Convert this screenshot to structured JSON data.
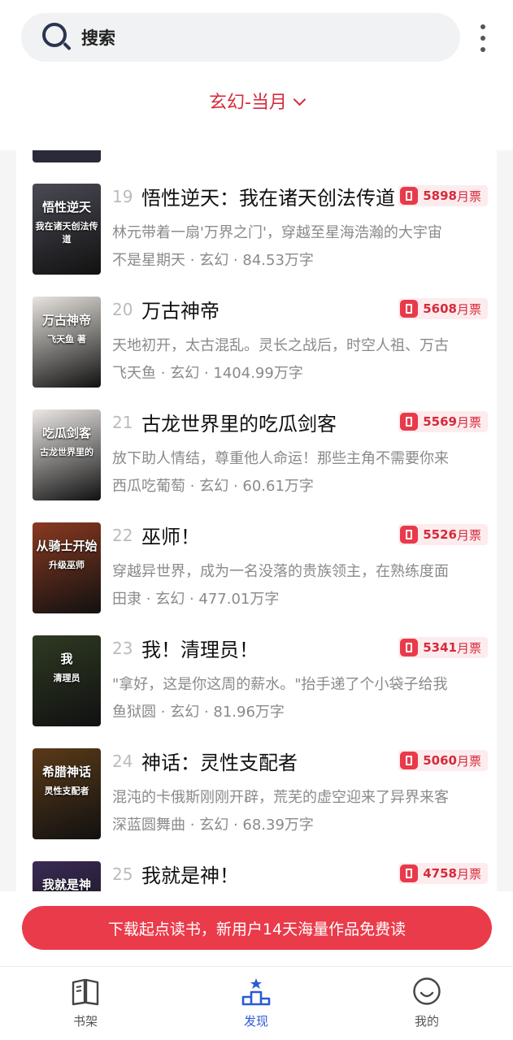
{
  "search": {
    "placeholder": "搜索"
  },
  "filter": {
    "label": "玄幻-当月"
  },
  "books": [
    {
      "rank": "19",
      "title": "悟性逆天：我在诸天创法传道",
      "tickets": "5898",
      "ticket_unit": "月票",
      "desc": "林元带着一扇'万界之门'，穿越至星海浩瀚的大宇宙",
      "author": "不是星期天",
      "genre": "玄幻",
      "words": "84.53万字",
      "cover": {
        "lines": [
          "悟性逆天",
          "我在诸天创法传道"
        ],
        "bg": "#4a4a55"
      }
    },
    {
      "rank": "20",
      "title": "万古神帝",
      "tickets": "5608",
      "ticket_unit": "月票",
      "desc": "天地初开，太古混乱。灵长之战后，时空人祖、万古",
      "author": "飞天鱼",
      "genre": "玄幻",
      "words": "1404.99万字",
      "cover": {
        "lines": [
          "万古神帝",
          "飞天鱼 著"
        ],
        "bg": "#e8e4de"
      }
    },
    {
      "rank": "21",
      "title": "古龙世界里的吃瓜剑客",
      "tickets": "5569",
      "ticket_unit": "月票",
      "desc": "放下助人情结，尊重他人命运！那些主角不需要你来",
      "author": "西瓜吃葡萄",
      "genre": "玄幻",
      "words": "60.61万字",
      "cover": {
        "lines": [
          "吃瓜剑客",
          "古龙世界里的"
        ],
        "bg": "#ece8e6"
      }
    },
    {
      "rank": "22",
      "title": "巫师！",
      "tickets": "5526",
      "ticket_unit": "月票",
      "desc": "穿越异世界，成为一名没落的贵族领主，在熟练度面",
      "author": "田隶",
      "genre": "玄幻",
      "words": "477.01万字",
      "cover": {
        "lines": [
          "从骑士开始",
          "升级巫师"
        ],
        "bg": "#8a3a20"
      }
    },
    {
      "rank": "23",
      "title": "我！清理员！",
      "tickets": "5341",
      "ticket_unit": "月票",
      "desc": "\"拿好，这是你这周的薪水。\"抬手递了个小袋子给我",
      "author": "鱼狱圆",
      "genre": "玄幻",
      "words": "81.96万字",
      "cover": {
        "lines": [
          "我",
          "清理员"
        ],
        "bg": "#2e3a22"
      }
    },
    {
      "rank": "24",
      "title": "神话：灵性支配者",
      "tickets": "5060",
      "ticket_unit": "月票",
      "desc": "混沌的卡俄斯刚刚开辟，荒芜的虚空迎来了异界来客",
      "author": "深蓝圆舞曲",
      "genre": "玄幻",
      "words": "68.39万字",
      "cover": {
        "lines": [
          "希腊神话",
          "灵性支配者"
        ],
        "bg": "#5a3a18"
      }
    },
    {
      "rank": "25",
      "title": "我就是神！",
      "tickets": "4758",
      "ticket_unit": "月票",
      "desc": "",
      "author": "",
      "genre": "",
      "words": "",
      "cover": {
        "lines": [
          "我就是神"
        ],
        "bg": "#3a2a55"
      }
    }
  ],
  "promo": {
    "text": "下载起点读书，新用户14天海量作品免费读"
  },
  "nav": [
    {
      "label": "书架",
      "icon": "book-icon",
      "active": false
    },
    {
      "label": "发现",
      "icon": "podium-icon",
      "active": true
    },
    {
      "label": "我的",
      "icon": "smile-icon",
      "active": false
    }
  ],
  "colors": {
    "accent": "#d62a3b",
    "promo": "#ea3b4a",
    "nav_active": "#2a5bd7"
  },
  "separator": "·"
}
